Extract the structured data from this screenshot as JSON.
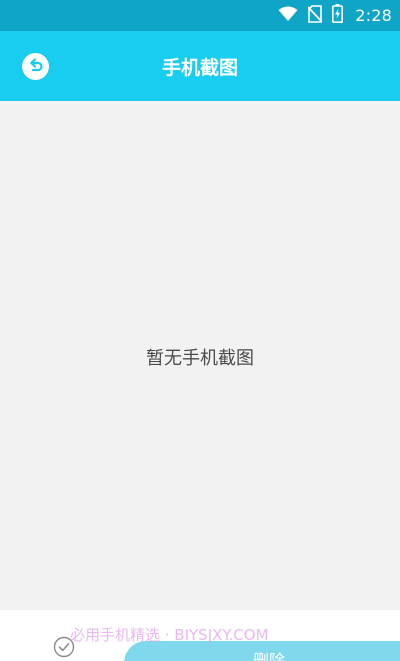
{
  "status_bar": {
    "time": "2:28",
    "icons": [
      "wifi-icon",
      "no-sim-icon",
      "battery-charging-icon"
    ]
  },
  "header": {
    "title": "手机截图",
    "back_icon": "back-arrow-icon"
  },
  "main": {
    "empty_message": "暂无手机截图"
  },
  "footer": {
    "select_icon": "check-circle-icon",
    "delete_label": "删除",
    "watermark": "必用手机精选 · BIYSJXY.COM"
  },
  "colors": {
    "status_bar": "#0ea5c6",
    "app_bar": "#19cdf0",
    "content_bg": "#f2f2f2",
    "delete_button": "#7fd8ec"
  }
}
